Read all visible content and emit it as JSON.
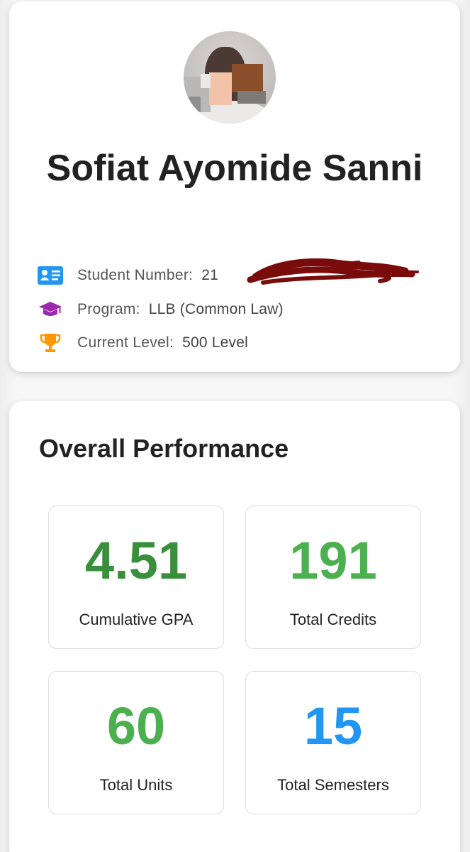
{
  "profile": {
    "name": "Sofiat Ayomide Sanni",
    "student_number": {
      "label": "Student Number:",
      "value": "21"
    },
    "program": {
      "label": "Program:",
      "value": "LLB (Common Law)"
    },
    "level": {
      "label": "Current Level:",
      "value": "500 Level"
    },
    "icons": {
      "student_number": "id-card-icon",
      "program": "graduation-cap-icon",
      "level": "trophy-icon"
    }
  },
  "performance": {
    "title": "Overall Performance",
    "stats": [
      {
        "value": "4.51",
        "label": "Cumulative GPA",
        "color": "#3a8f3c"
      },
      {
        "value": "191",
        "label": "Total Credits",
        "color": "#4caf50"
      },
      {
        "value": "60",
        "label": "Total Units",
        "color": "#4caf50"
      },
      {
        "value": "15",
        "label": "Total Semesters",
        "color": "#2196f3"
      }
    ]
  },
  "colors": {
    "id_icon": "#2196f3",
    "program_icon": "#9c27b0",
    "trophy_icon": "#ff9800",
    "redaction": "#7a0b0b"
  }
}
